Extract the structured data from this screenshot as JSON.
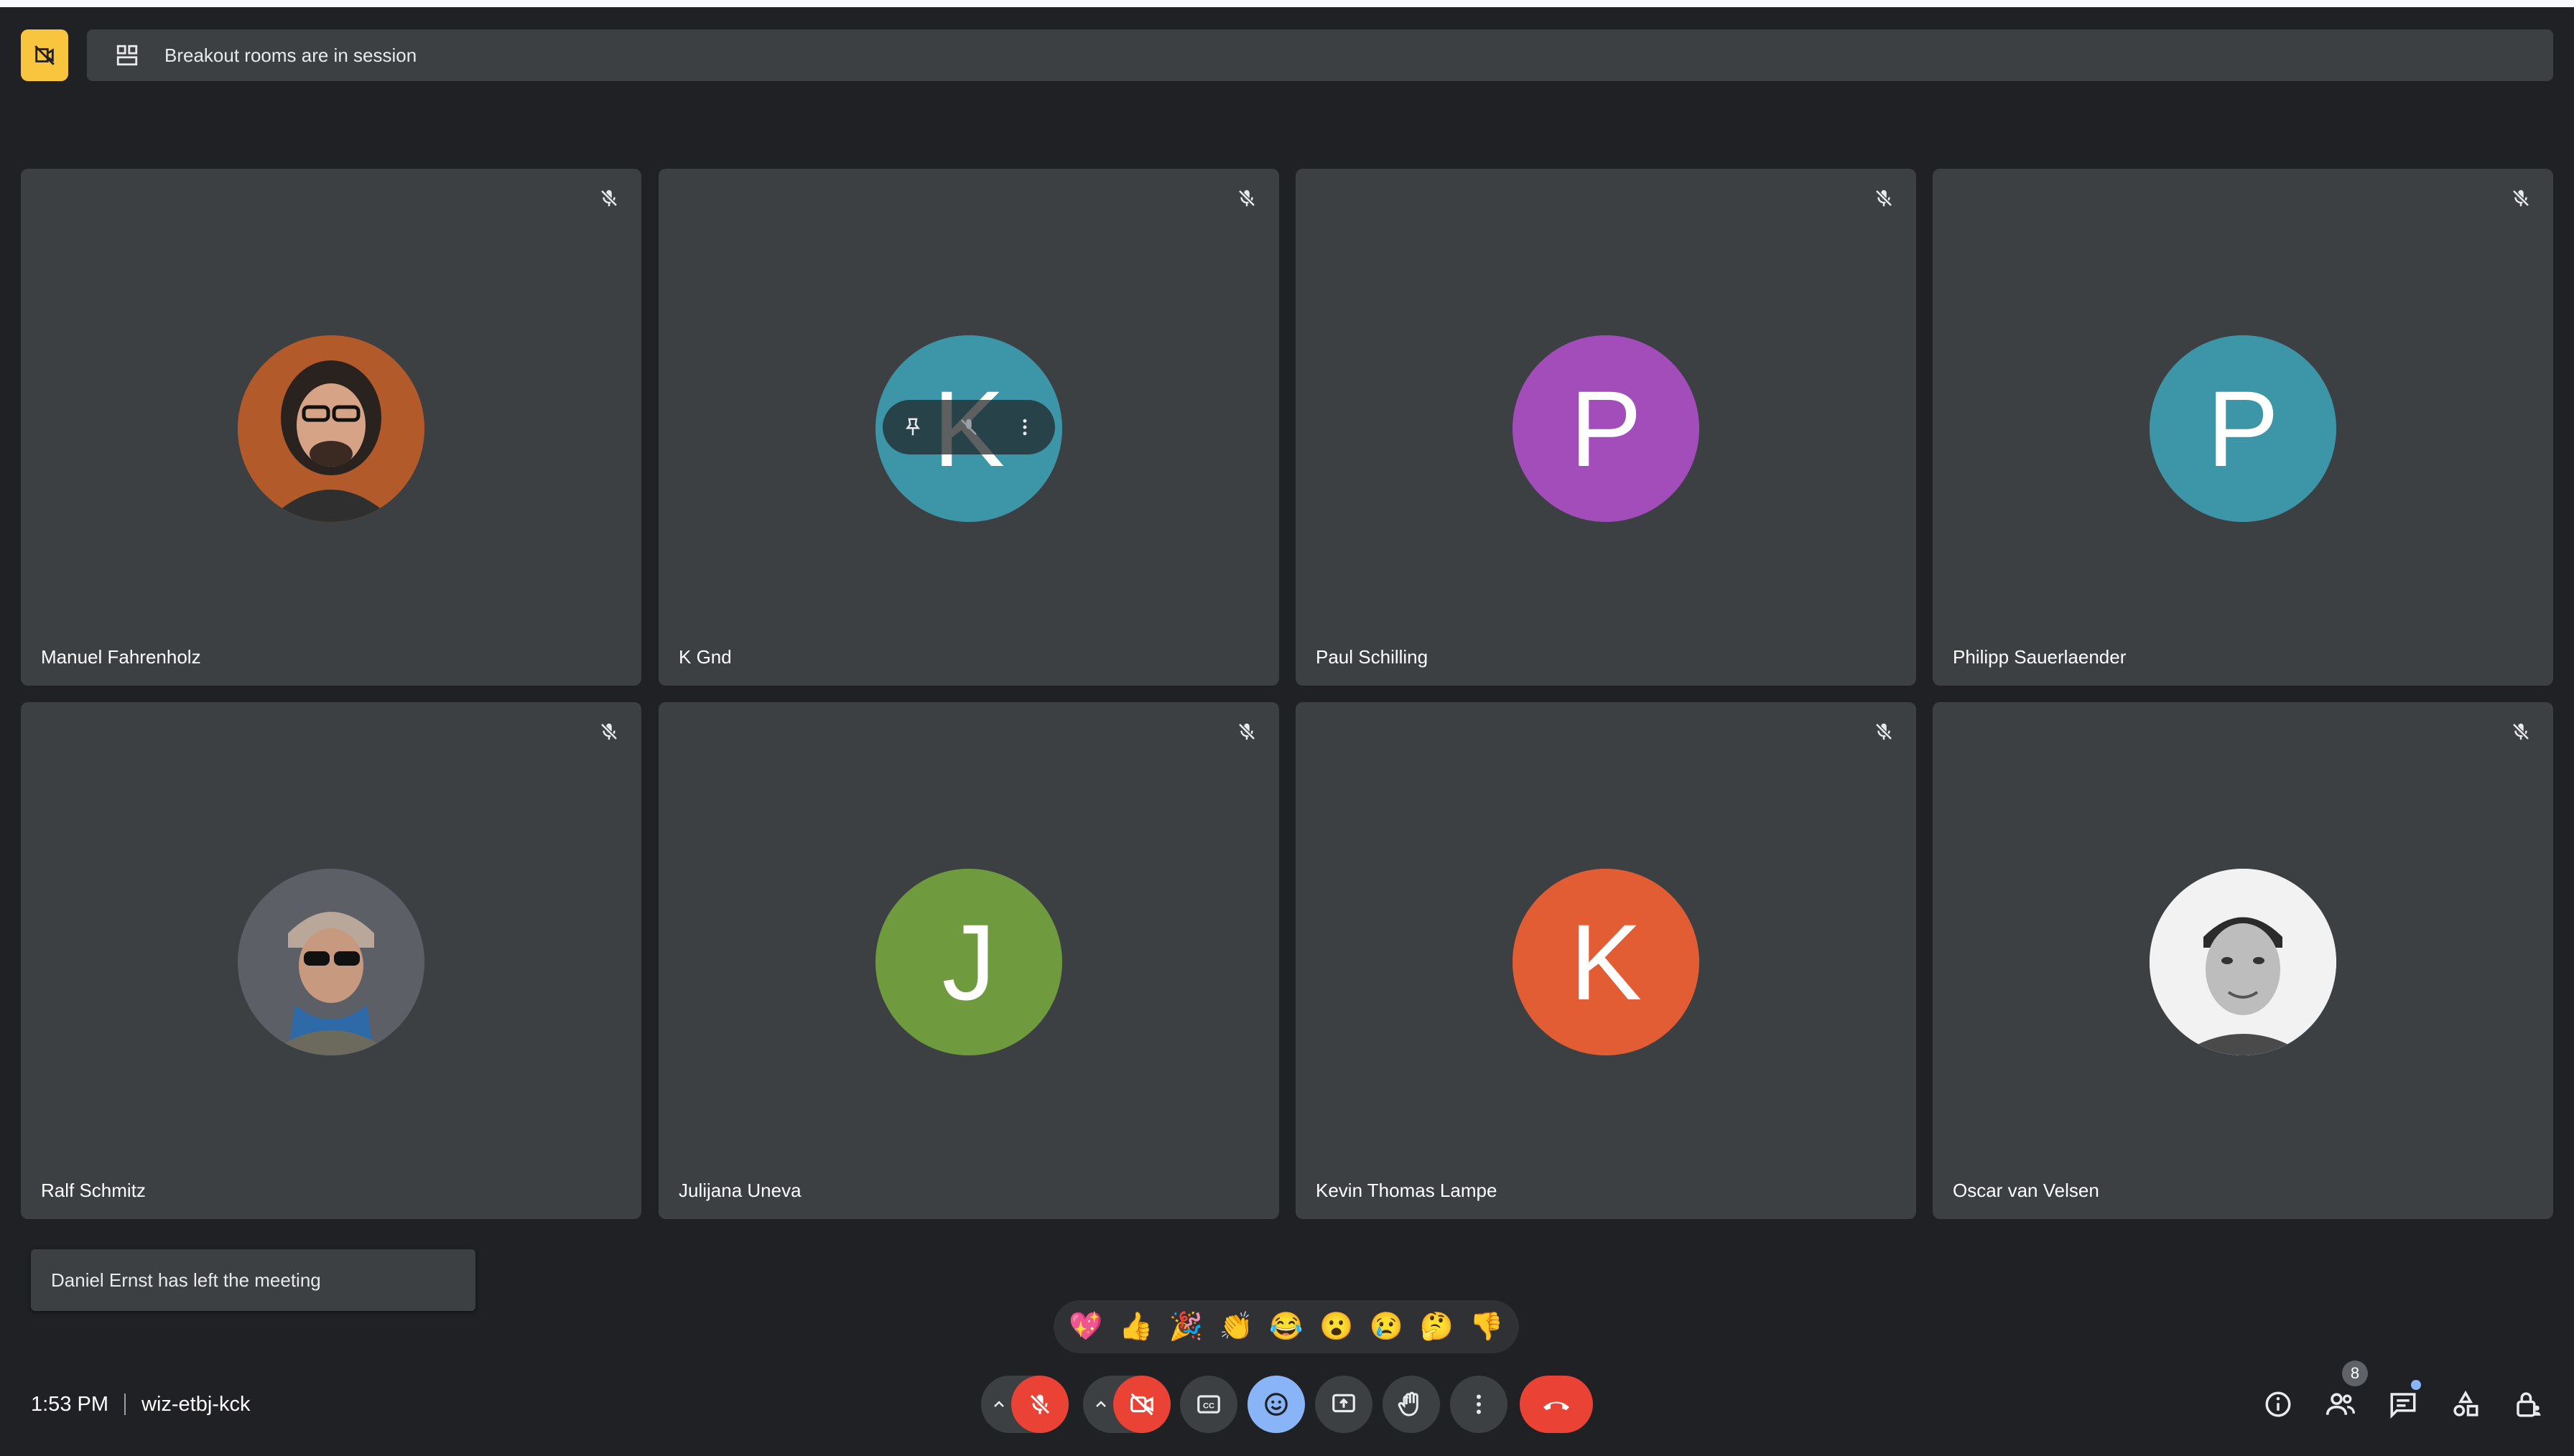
{
  "banner": {
    "text": "Breakout rooms are in session"
  },
  "participants": [
    {
      "name": "Manuel Fahrenholz",
      "initial": "",
      "avatar_color": "#9c4a21",
      "photo": true
    },
    {
      "name": "K Gnd",
      "initial": "K",
      "avatar_color": "#3d96a8",
      "photo": false
    },
    {
      "name": "Paul Schilling",
      "initial": "P",
      "avatar_color": "#a34dbb",
      "photo": false
    },
    {
      "name": "Philipp Sauerlaender",
      "initial": "P",
      "avatar_color": "#3d96a8",
      "photo": false
    },
    {
      "name": "Ralf Schmitz",
      "initial": "",
      "avatar_color": "#55595e",
      "photo": true
    },
    {
      "name": "Julijana Uneva",
      "initial": "J",
      "avatar_color": "#6f9b3e",
      "photo": false
    },
    {
      "name": "Kevin Thomas Lampe",
      "initial": "K",
      "avatar_color": "#e25d33",
      "photo": false
    },
    {
      "name": "Oscar van Velsen",
      "initial": "",
      "avatar_color": "#d9d9d9",
      "photo": true
    }
  ],
  "toast": {
    "text": "Daniel Ernst has left the meeting"
  },
  "reactions": [
    "💖",
    "👍",
    "🎉",
    "👏",
    "😂",
    "😮",
    "😢",
    "🤔",
    "👎"
  ],
  "meeting": {
    "time": "1:53 PM",
    "code": "wiz-etbj-kck"
  },
  "people_count": "8",
  "colors": {
    "background": "#202124",
    "tile": "#3c4043",
    "end_call": "#ea4335",
    "accent_blue": "#8ab4f8",
    "rec_badge": "#f9c53f"
  }
}
